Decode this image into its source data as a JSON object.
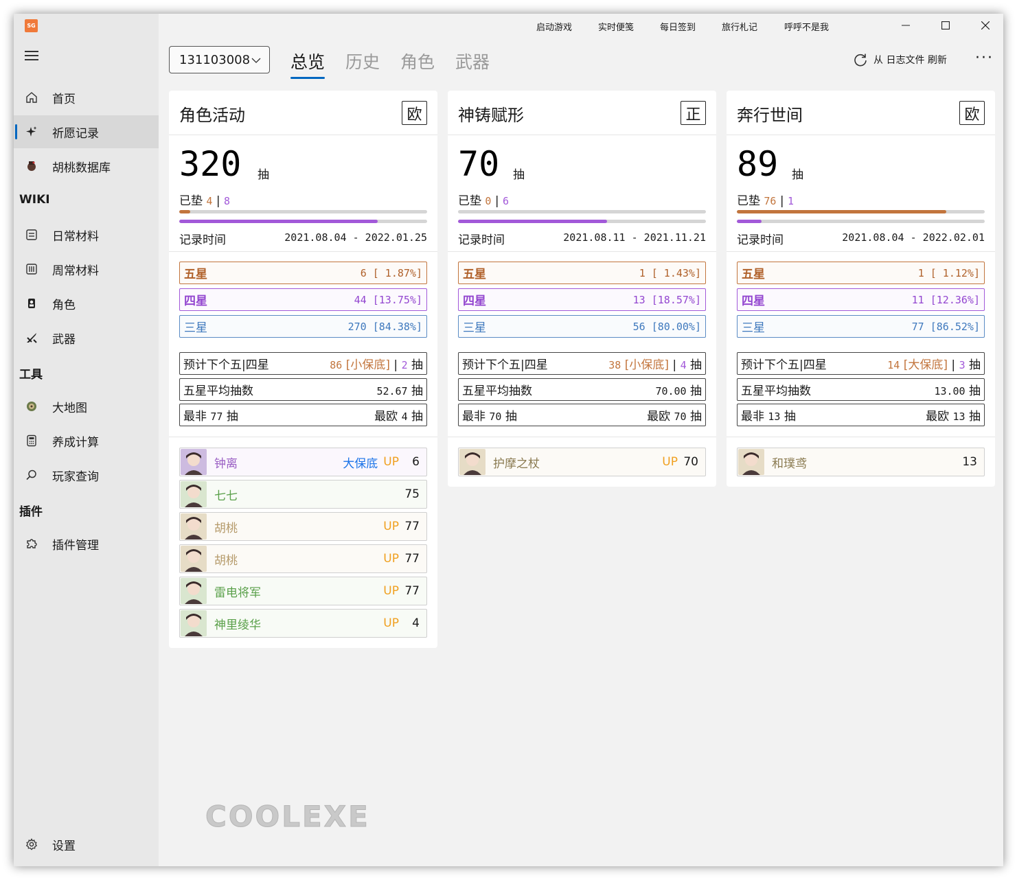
{
  "app": {
    "logo_text": "SG"
  },
  "titlebar": {
    "links": [
      "启动游戏",
      "实时便笺",
      "每日签到",
      "旅行札记",
      "呼呼不是我"
    ]
  },
  "sidebar": {
    "items": [
      {
        "label": "首页",
        "icon": "home-icon"
      },
      {
        "label": "祈愿记录",
        "icon": "sparkle-icon",
        "active": true
      },
      {
        "label": "胡桃数据库",
        "icon": "hutao-icon"
      }
    ],
    "wiki_header": "WIKI",
    "wiki_items": [
      {
        "label": "日常材料",
        "icon": "daily-material-icon"
      },
      {
        "label": "周常材料",
        "icon": "weekly-material-icon"
      },
      {
        "label": "角色",
        "icon": "character-icon"
      },
      {
        "label": "武器",
        "icon": "weapon-icon"
      }
    ],
    "tools_header": "工具",
    "tools_items": [
      {
        "label": "大地图",
        "icon": "map-icon"
      },
      {
        "label": "养成计算",
        "icon": "calculator-icon"
      },
      {
        "label": "玩家查询",
        "icon": "search-icon"
      }
    ],
    "plugins_header": "插件",
    "plugins_items": [
      {
        "label": "插件管理",
        "icon": "puzzle-icon"
      }
    ],
    "settings_label": "设置"
  },
  "toolbar": {
    "uid": "131103008",
    "tabs": [
      "总览",
      "历史",
      "角色",
      "武器"
    ],
    "active_tab": "总览",
    "refresh_label": "从 日志文件 刷新"
  },
  "colors": {
    "five_star": "#c2753d",
    "four_star": "#a259d9",
    "three_star": "#5a8bc4",
    "accent": "#0067c0",
    "up": "#f0a020"
  },
  "cards": [
    {
      "title": "角色活动",
      "badge": "欧",
      "total": "320",
      "unit": "抽",
      "pity_label": "已垫",
      "pity_five": "4",
      "pity_four": "8",
      "pity_five_progress": 0.044,
      "pity_four_progress": 0.8,
      "record_label": "记录时间",
      "record_range": "2021.08.04 - 2022.01.25",
      "five": {
        "label": "五星",
        "value": "6 [ 1.87%]"
      },
      "four": {
        "label": "四星",
        "value": "44 [13.75%]"
      },
      "three": {
        "label": "三星",
        "value": "270 [84.38%]"
      },
      "predict_label": "预计下个五|四星",
      "predict_five": "86",
      "predict_type": "[小保底]",
      "predict_four": "2",
      "predict_unit": "抽",
      "avg_label": "五星平均抽数",
      "avg_value": "52.67",
      "avg_unit": "抽",
      "worst_label": "最非",
      "worst_value": "77",
      "best_label": "最欧",
      "best_value": "4",
      "items": [
        {
          "name": "钟离",
          "guarantee": "大保底",
          "up": "UP",
          "count": "6",
          "color": "#9a5fc4",
          "tone": "purple"
        },
        {
          "name": "七七",
          "guarantee": "",
          "up": "",
          "count": "75",
          "color": "#5aa04a",
          "tone": "green"
        },
        {
          "name": "胡桃",
          "guarantee": "",
          "up": "UP",
          "count": "77",
          "color": "#b59a6a",
          "tone": "gold"
        },
        {
          "name": "胡桃",
          "guarantee": "",
          "up": "UP",
          "count": "77",
          "color": "#b59a6a",
          "tone": "gold"
        },
        {
          "name": "雷电将军",
          "guarantee": "",
          "up": "UP",
          "count": "77",
          "color": "#5aa04a",
          "tone": "green"
        },
        {
          "name": "神里绫华",
          "guarantee": "",
          "up": "UP",
          "count": "4",
          "color": "#5aa04a",
          "tone": "green"
        }
      ]
    },
    {
      "title": "神铸赋形",
      "badge": "正",
      "total": "70",
      "unit": "抽",
      "pity_label": "已垫",
      "pity_five": "0",
      "pity_four": "6",
      "pity_five_progress": 0.0,
      "pity_four_progress": 0.6,
      "record_label": "记录时间",
      "record_range": "2021.08.11 - 2021.11.21",
      "five": {
        "label": "五星",
        "value": "1 [ 1.43%]"
      },
      "four": {
        "label": "四星",
        "value": "13 [18.57%]"
      },
      "three": {
        "label": "三星",
        "value": "56 [80.00%]"
      },
      "predict_label": "预计下个五|四星",
      "predict_five": "38",
      "predict_type": "[小保底]",
      "predict_four": "4",
      "predict_unit": "抽",
      "avg_label": "五星平均抽数",
      "avg_value": "70.00",
      "avg_unit": "抽",
      "worst_label": "最非",
      "worst_value": "70",
      "best_label": "最欧",
      "best_value": "70",
      "items": [
        {
          "name": "护摩之杖",
          "guarantee": "",
          "up": "UP",
          "count": "70",
          "color": "#8a7a50",
          "tone": "gold"
        }
      ]
    },
    {
      "title": "奔行世间",
      "badge": "欧",
      "total": "89",
      "unit": "抽",
      "pity_label": "已垫",
      "pity_five": "76",
      "pity_four": "1",
      "pity_five_progress": 0.844,
      "pity_four_progress": 0.1,
      "record_label": "记录时间",
      "record_range": "2021.08.04 - 2022.02.01",
      "five": {
        "label": "五星",
        "value": "1 [ 1.12%]"
      },
      "four": {
        "label": "四星",
        "value": "11 [12.36%]"
      },
      "three": {
        "label": "三星",
        "value": "77 [86.52%]"
      },
      "predict_label": "预计下个五|四星",
      "predict_five": "14",
      "predict_type": "[大保底]",
      "predict_four": "3",
      "predict_unit": "抽",
      "avg_label": "五星平均抽数",
      "avg_value": "13.00",
      "avg_unit": "抽",
      "worst_label": "最非",
      "worst_value": "13",
      "best_label": "最欧",
      "best_value": "13",
      "items": [
        {
          "name": "和璞鸢",
          "guarantee": "",
          "up": "",
          "count": "13",
          "color": "#8a7a50",
          "tone": "gold"
        }
      ]
    }
  ],
  "watermark": "COOLEXE"
}
